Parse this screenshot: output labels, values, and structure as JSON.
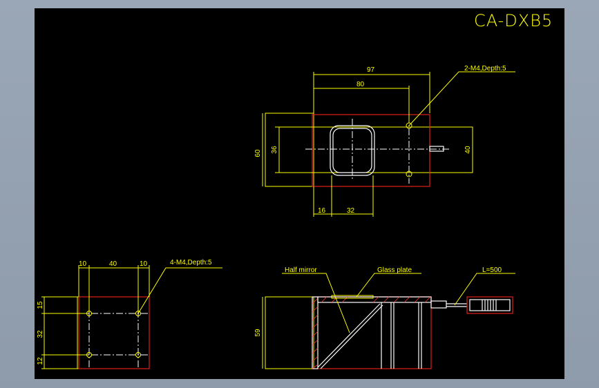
{
  "title": "CA-DXB5",
  "colors": {
    "background": "#000000",
    "dimension": "#ffff00",
    "outline": "#e0201c",
    "body": "#ffffff"
  },
  "top_view": {
    "dim_width_total": "97",
    "dim_width_inner": "80",
    "dim_height_total": "60",
    "dim_height_window": "36",
    "dim_height_right": "40",
    "dim_offset_left": "16",
    "dim_window_width": "32",
    "hole_note": "2-M4,Depth:5"
  },
  "side_view": {
    "dim_left": "10",
    "dim_center": "40",
    "dim_right": "10",
    "dim_top": "15",
    "dim_middle": "32",
    "dim_bottom": "12",
    "hole_note": "4-M4,Depth:5"
  },
  "front_view": {
    "half_mirror_label": "Half mirror",
    "glass_plate_label": "Glass plate",
    "cable_label": "L=500",
    "dim_height": "59"
  }
}
